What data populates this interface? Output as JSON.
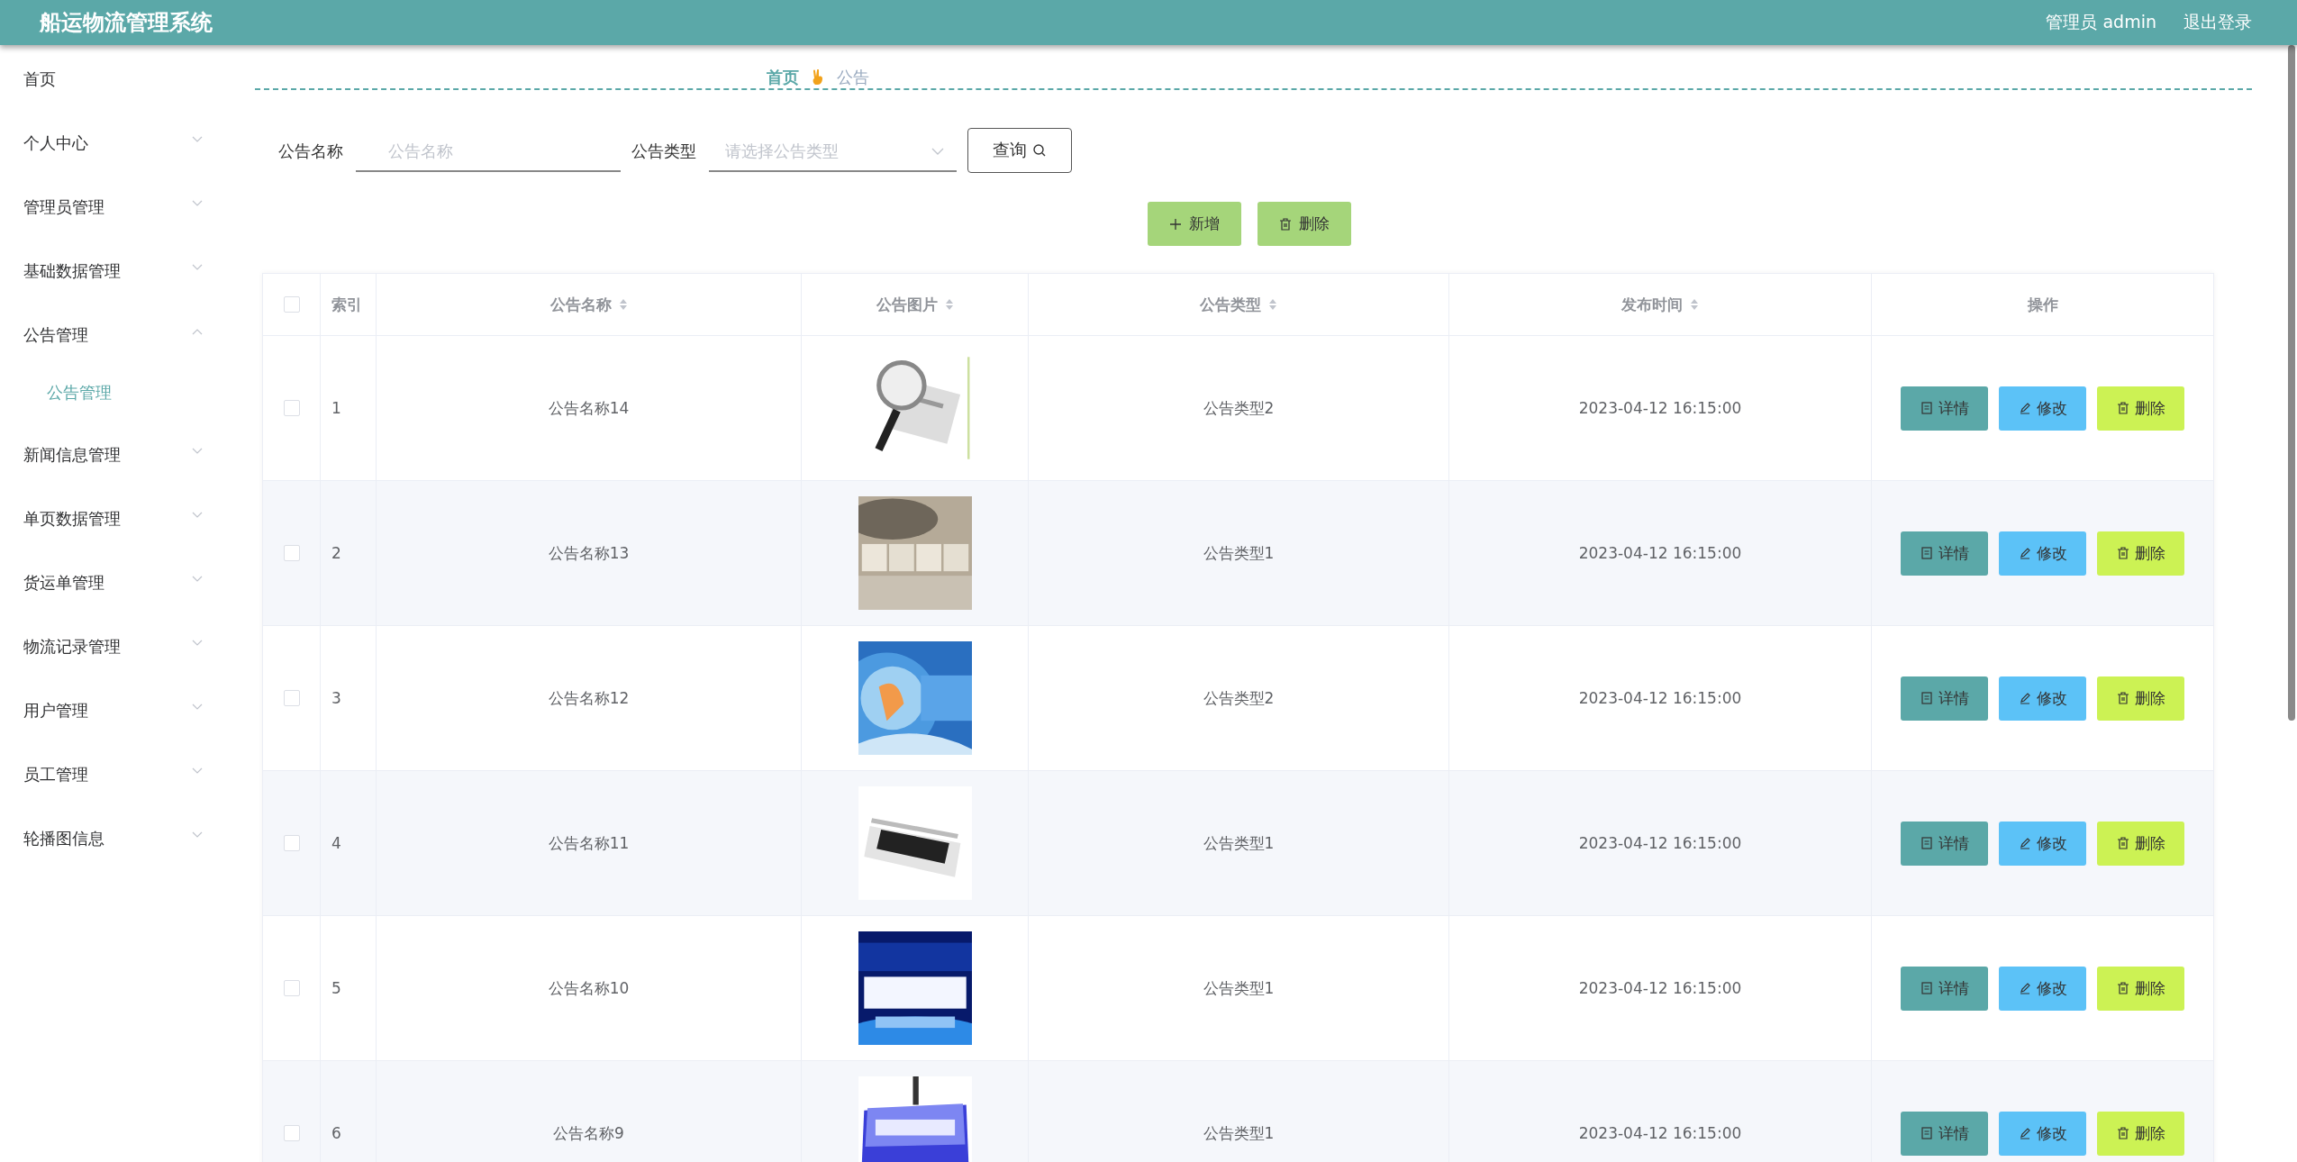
{
  "header": {
    "title": "船运物流管理系统",
    "user": "管理员 admin",
    "logout": "退出登录"
  },
  "sidebar": {
    "items": [
      {
        "label": "首页"
      },
      {
        "label": "个人中心",
        "has_children": true,
        "expanded": false
      },
      {
        "label": "管理员管理",
        "has_children": true,
        "expanded": false
      },
      {
        "label": "基础数据管理",
        "has_children": true,
        "expanded": false
      },
      {
        "label": "公告管理",
        "has_children": true,
        "expanded": true,
        "children": [
          {
            "label": "公告管理",
            "selected": true
          }
        ]
      },
      {
        "label": "新闻信息管理",
        "has_children": true,
        "expanded": false
      },
      {
        "label": "单页数据管理",
        "has_children": true,
        "expanded": false
      },
      {
        "label": "货运单管理",
        "has_children": true,
        "expanded": false
      },
      {
        "label": "物流记录管理",
        "has_children": true,
        "expanded": false
      },
      {
        "label": "用户管理",
        "has_children": true,
        "expanded": false
      },
      {
        "label": "员工管理",
        "has_children": true,
        "expanded": false
      },
      {
        "label": "轮播图信息",
        "has_children": true,
        "expanded": false
      }
    ]
  },
  "breadcrumb": [
    "首页",
    "公告"
  ],
  "filters": [
    {
      "label": "公告名称",
      "kind": "text",
      "placeholder": "公告名称"
    },
    {
      "label": "公告类型",
      "kind": "select",
      "placeholder": "请选择公告类型"
    }
  ],
  "search_button": "查询",
  "toolbar": [
    {
      "label": "新增",
      "kind": "add"
    },
    {
      "label": "删除",
      "kind": "delete"
    }
  ],
  "table": {
    "select_all_checked": false,
    "columns": [
      {
        "label": "索引",
        "sortable": false
      },
      {
        "label": "公告名称",
        "sortable": true
      },
      {
        "label": "公告图片",
        "sortable": true
      },
      {
        "label": "公告类型",
        "sortable": true
      },
      {
        "label": "发布时间",
        "sortable": true
      },
      {
        "label": "操作",
        "sortable": false
      }
    ],
    "rows": [
      {
        "checked": false,
        "index": "1",
        "name": "公告名称14",
        "type": "公告类型2",
        "time": "2023-04-12 16:15:00",
        "actions": [
          {
            "label": "详情",
            "kind": "detail"
          },
          {
            "label": "修改",
            "kind": "edit"
          },
          {
            "label": "删除",
            "kind": "delete"
          }
        ]
      },
      {
        "checked": false,
        "index": "2",
        "name": "公告名称13",
        "type": "公告类型1",
        "time": "2023-04-12 16:15:00",
        "actions": [
          {
            "label": "详情",
            "kind": "detail"
          },
          {
            "label": "修改",
            "kind": "edit"
          },
          {
            "label": "删除",
            "kind": "delete"
          }
        ]
      },
      {
        "checked": false,
        "index": "3",
        "name": "公告名称12",
        "type": "公告类型2",
        "time": "2023-04-12 16:15:00",
        "actions": [
          {
            "label": "详情",
            "kind": "detail"
          },
          {
            "label": "修改",
            "kind": "edit"
          },
          {
            "label": "删除",
            "kind": "delete"
          }
        ]
      },
      {
        "checked": false,
        "index": "4",
        "name": "公告名称11",
        "type": "公告类型1",
        "time": "2023-04-12 16:15:00",
        "actions": [
          {
            "label": "详情",
            "kind": "detail"
          },
          {
            "label": "修改",
            "kind": "edit"
          },
          {
            "label": "删除",
            "kind": "delete"
          }
        ]
      },
      {
        "checked": false,
        "index": "5",
        "name": "公告名称10",
        "type": "公告类型1",
        "time": "2023-04-12 16:15:00",
        "actions": [
          {
            "label": "详情",
            "kind": "detail"
          },
          {
            "label": "修改",
            "kind": "edit"
          },
          {
            "label": "删除",
            "kind": "delete"
          }
        ]
      },
      {
        "checked": false,
        "index": "6",
        "name": "公告名称9",
        "type": "公告类型1",
        "time": "2023-04-12 16:15:00",
        "actions": [
          {
            "label": "详情",
            "kind": "detail"
          },
          {
            "label": "修改",
            "kind": "edit"
          },
          {
            "label": "删除",
            "kind": "delete"
          }
        ]
      }
    ]
  }
}
